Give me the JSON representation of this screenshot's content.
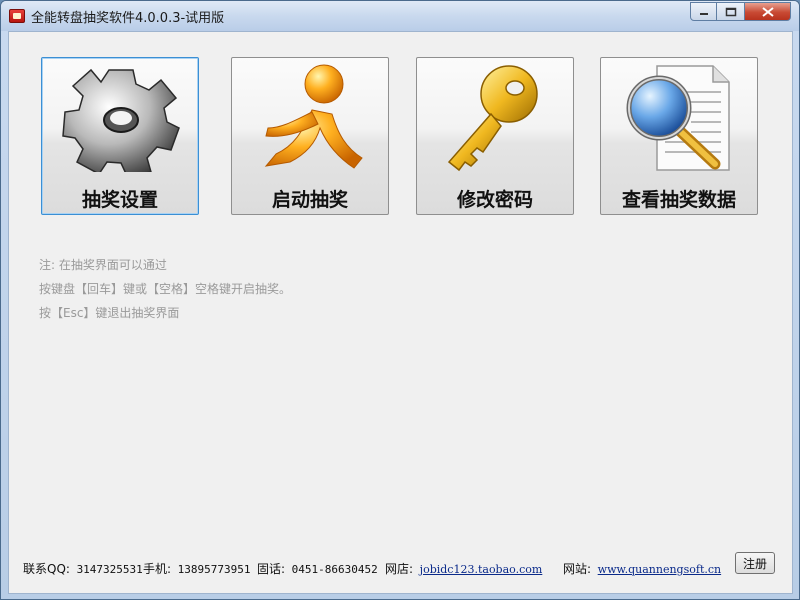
{
  "window": {
    "title": "全能转盘抽奖软件4.0.0.3-试用版"
  },
  "controls": {
    "minimize": "▭",
    "maximize": "▢",
    "close": "✕"
  },
  "tiles": [
    {
      "label": "抽奖设置",
      "icon": "gear-icon",
      "selected": true
    },
    {
      "label": "启动抽奖",
      "icon": "running-man-icon",
      "selected": false
    },
    {
      "label": "修改密码",
      "icon": "key-icon",
      "selected": false
    },
    {
      "label": "查看抽奖数据",
      "icon": "document-search-icon",
      "selected": false
    }
  ],
  "notes": [
    "注: 在抽奖界面可以通过",
    "按键盘【回车】键或【空格】空格键开启抽奖。",
    "按【Esc】键退出抽奖界面"
  ],
  "footer": {
    "qq_label": "联系QQ:",
    "qq_value": "3147325531",
    "phone_label": "手机:",
    "phone_value": "13895773951",
    "tel_label": "固话:",
    "tel_value": "0451-86630452",
    "shop_label": "网店:",
    "shop_link": "jobidc123.taobao.com",
    "site_label": "网站:",
    "site_link": "www.quannengsoft.cn"
  },
  "register_button": "注册"
}
